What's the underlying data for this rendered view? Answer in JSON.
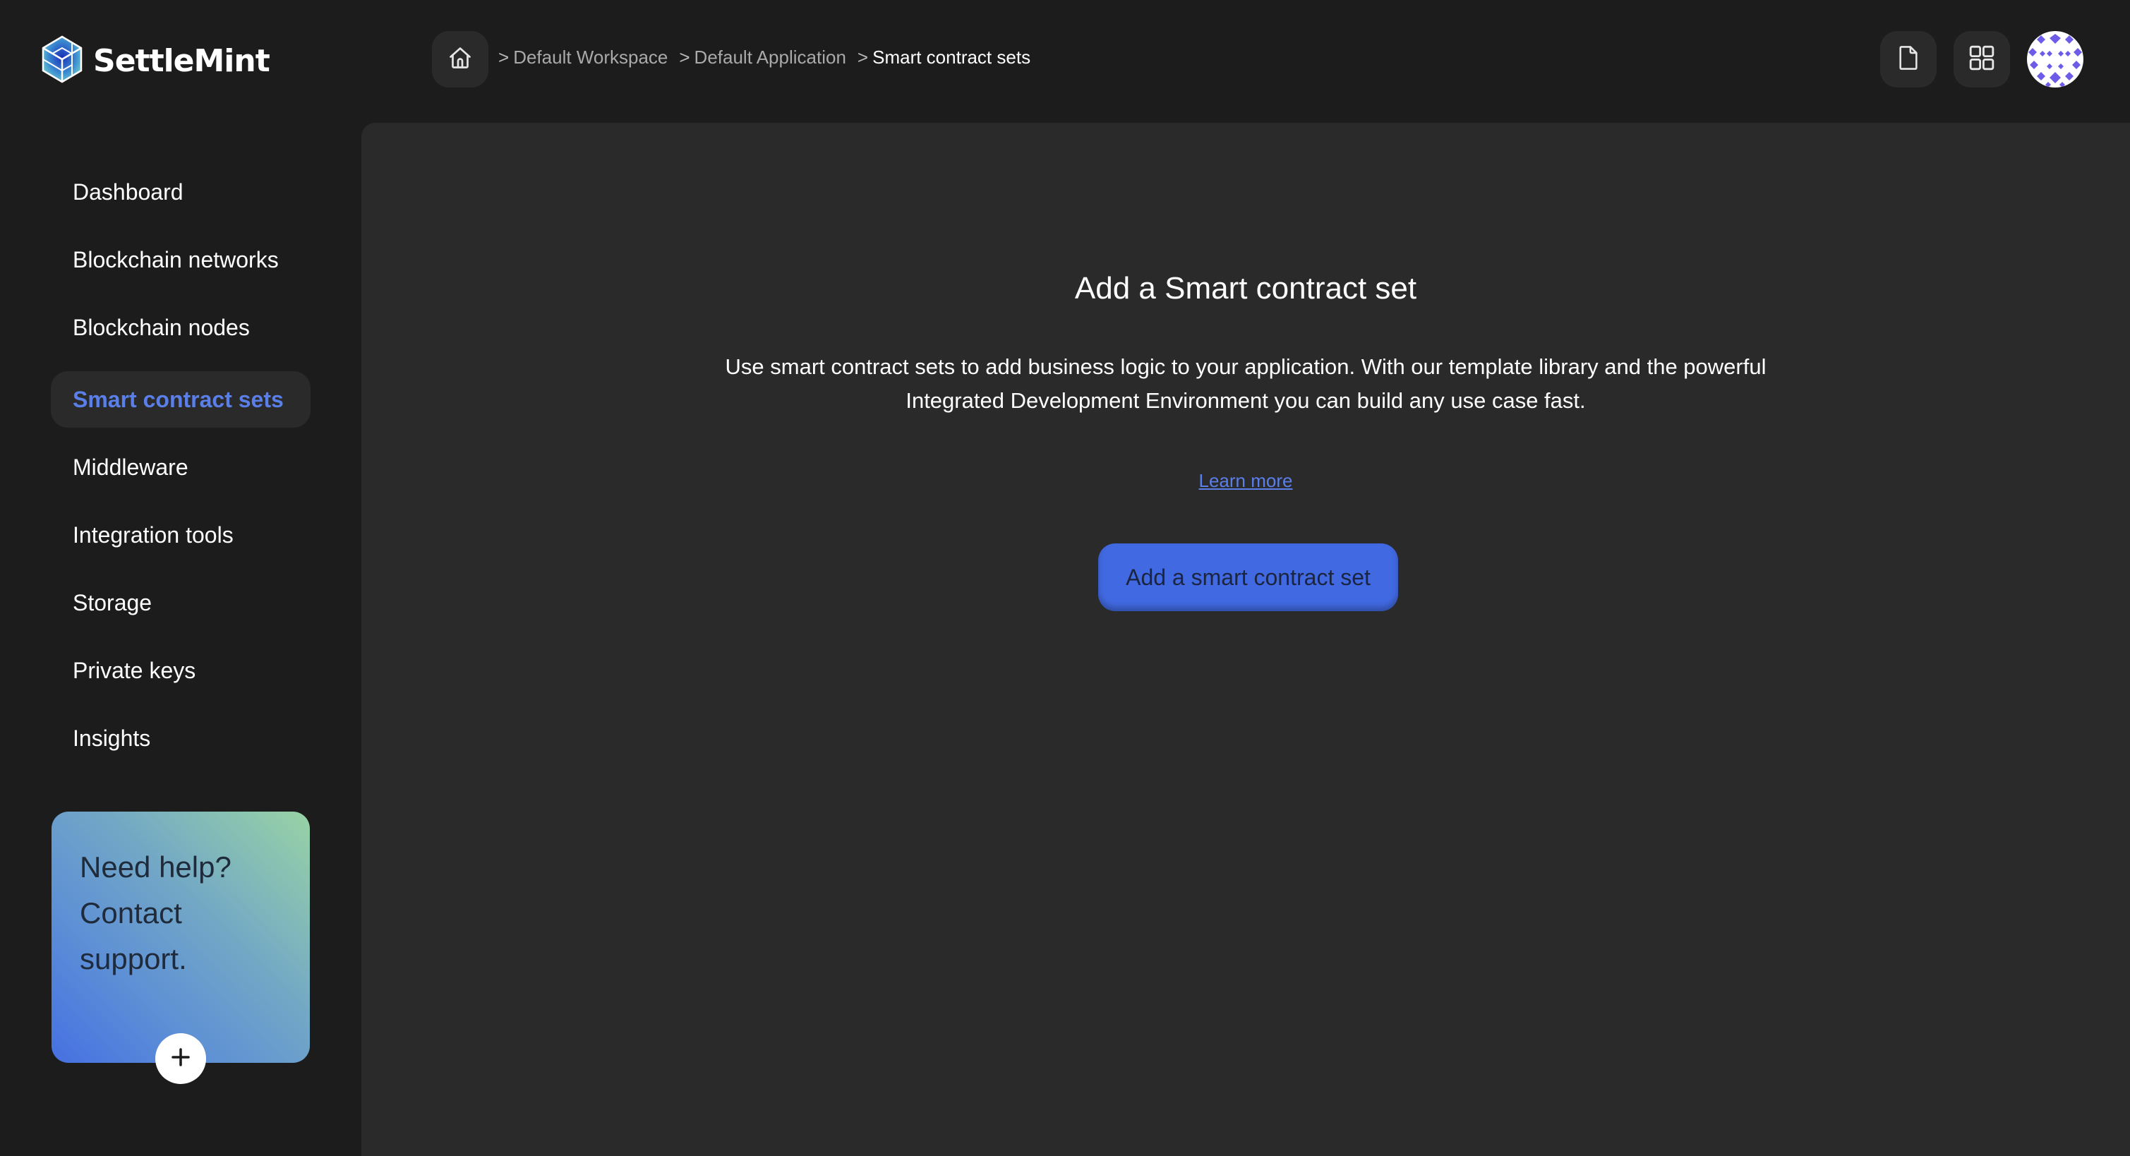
{
  "app": {
    "brand": "SettleMint"
  },
  "header": {
    "home_icon": "home-icon",
    "breadcrumb": [
      {
        "label": "Default Workspace"
      },
      {
        "label": "Default Application"
      },
      {
        "label": "Smart contract sets",
        "current": true
      }
    ],
    "separator": ">",
    "actions": [
      {
        "icon": "document-icon"
      },
      {
        "icon": "grid-icon"
      }
    ],
    "avatar_color": "#6c5ce7"
  },
  "sidebar": {
    "items": [
      {
        "label": "Dashboard"
      },
      {
        "label": "Blockchain networks"
      },
      {
        "label": "Blockchain nodes"
      },
      {
        "label": "Smart contract sets",
        "active": true
      },
      {
        "label": "Middleware"
      },
      {
        "label": "Integration tools"
      },
      {
        "label": "Storage"
      },
      {
        "label": "Private keys"
      },
      {
        "label": "Insights"
      }
    ],
    "help_card": {
      "text": "Need help? Contact support.",
      "button_icon": "plus-icon"
    }
  },
  "main": {
    "title": "Add a Smart contract set",
    "description_line1": "Use smart contract sets to add business logic to your application. With our template library and the powerful",
    "description_line2": "Integrated Development Environment you can build any use case fast.",
    "learn_more": "Learn more",
    "cta_label": "Add a smart contract set"
  },
  "colors": {
    "accent": "#4169e1",
    "active_text": "#5b7fe8",
    "background": "#1c1c1c",
    "panel": "#2a2a2a"
  }
}
